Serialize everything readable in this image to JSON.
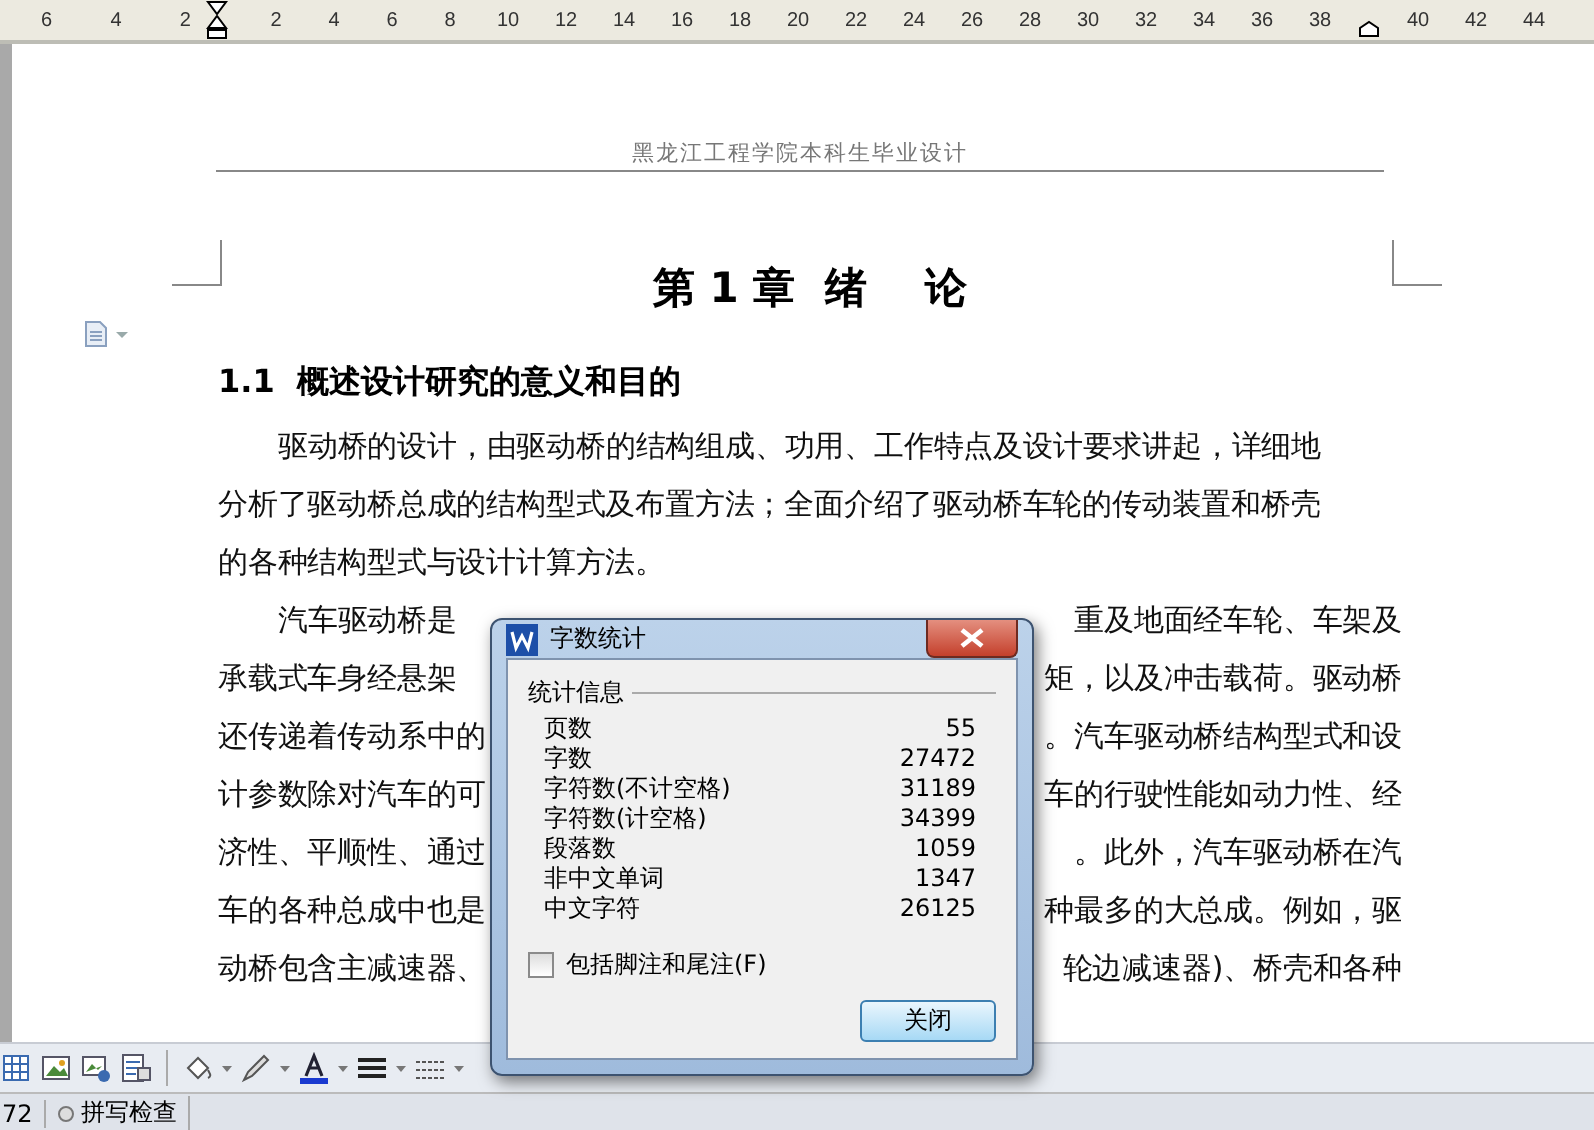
{
  "ruler": {
    "left_labels": [
      "6",
      "4",
      "2"
    ],
    "right_labels": [
      "2",
      "4",
      "6",
      "8",
      "10",
      "12",
      "14",
      "16",
      "18",
      "20",
      "22",
      "24",
      "26",
      "28",
      "30",
      "32",
      "34",
      "36",
      "38",
      "40",
      "42",
      "44"
    ]
  },
  "page": {
    "header": "黑龙江工程学院本科生毕业设计",
    "chapter_title": "第 1 章  绪    论",
    "section_heading": "1.1  概述设计研究的意义和目的",
    "paragraph_1": [
      "驱动桥的设计，由驱动桥的结构组成、功用、工作特点及设计要求讲起，详细地",
      "分析了驱动桥总成的结构型式及布置方法；全面介绍了驱动桥车轮的传动装置和桥壳",
      "的各种结构型式与设计计算方法。"
    ],
    "paragraph_2": [
      {
        "left": "汽车驱动桥是",
        "right": "重及地面经车轮、车架及"
      },
      {
        "left": "承载式车身经悬架",
        "right": "矩，以及冲击载荷。驱动桥"
      },
      {
        "left": "还传递着传动系中的",
        "right": "。汽车驱动桥结构型式和设"
      },
      {
        "left": "计参数除对汽车的可",
        "right": "车的行驶性能如动力性、经"
      },
      {
        "left": "济性、平顺性、通过",
        "right": "。此外，汽车驱动桥在汽"
      },
      {
        "left": "车的各种总成中也是",
        "right": "种最多的大总成。例如，驱"
      },
      {
        "left": "动桥包含主减速器、",
        "right": "轮边减速器)、桥壳和各种"
      }
    ]
  },
  "dialog": {
    "title": "字数统计",
    "group_title": "统计信息",
    "stats": [
      {
        "label": "页数",
        "value": "55"
      },
      {
        "label": "字数",
        "value": "27472"
      },
      {
        "label": "字符数(不计空格)",
        "value": "31189"
      },
      {
        "label": "字符数(计空格)",
        "value": "34399"
      },
      {
        "label": "段落数",
        "value": "1059"
      },
      {
        "label": "非中文单词",
        "value": "1347"
      },
      {
        "label": "中文字符",
        "value": "26125"
      }
    ],
    "include_notes": {
      "label": "包括脚注和尾注(F)",
      "checked": false
    },
    "close_button": "关闭"
  },
  "status_bar": {
    "page_number": "72",
    "spell_check": "拼写检查"
  }
}
